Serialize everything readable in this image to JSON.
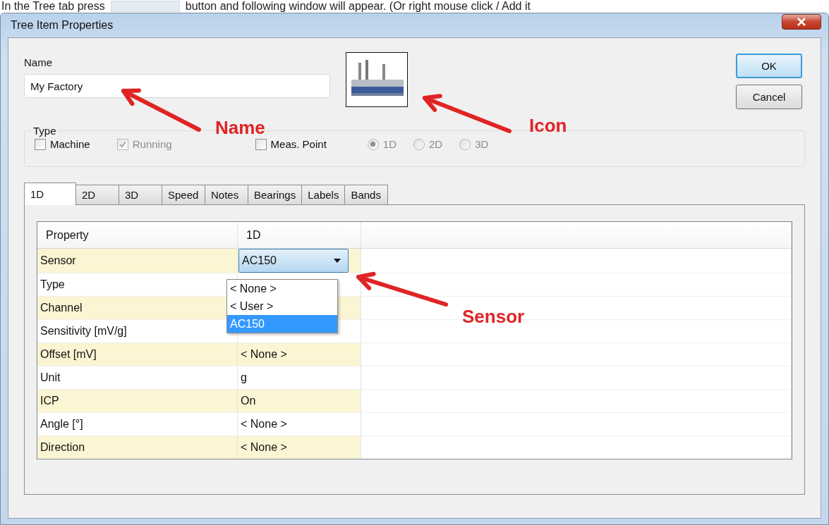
{
  "caption": {
    "before": "In the Tree tab press",
    "after": "button and following window will appear. (Or right mouse click / Add it"
  },
  "window": {
    "title": "Tree Item Properties"
  },
  "name": {
    "label": "Name",
    "value": "My Factory"
  },
  "buttons": [
    {
      "label": "OK",
      "default": true
    },
    {
      "label": "Cancel",
      "default": false
    }
  ],
  "type_group": {
    "label": "Type",
    "options": [
      {
        "kind": "checkbox",
        "label": "Machine",
        "checked": false,
        "disabled": false
      },
      {
        "kind": "checkbox",
        "label": "Running",
        "checked": true,
        "disabled": true
      },
      {
        "kind": "checkbox",
        "label": "Meas. Point",
        "checked": false,
        "disabled": false
      },
      {
        "kind": "radio",
        "label": "1D",
        "selected": true,
        "disabled": true
      },
      {
        "kind": "radio",
        "label": "2D",
        "selected": false,
        "disabled": true
      },
      {
        "kind": "radio",
        "label": "3D",
        "selected": false,
        "disabled": true
      }
    ]
  },
  "tabs": [
    {
      "label": "1D",
      "selected": true
    },
    {
      "label": "2D",
      "selected": false
    },
    {
      "label": "3D",
      "selected": false
    },
    {
      "label": "Speed",
      "selected": false
    },
    {
      "label": "Notes",
      "selected": false
    },
    {
      "label": "Bearings",
      "selected": false
    },
    {
      "label": "Labels",
      "selected": false
    },
    {
      "label": "Bands",
      "selected": false
    }
  ],
  "grid": {
    "columns": [
      "Property",
      "1D"
    ],
    "rows": [
      {
        "property": "Sensor",
        "kind": "combo",
        "value": "AC150"
      },
      {
        "property": "Type",
        "kind": "text"
      },
      {
        "property": "Channel",
        "kind": "text"
      },
      {
        "property": "Sensitivity [mV/g]",
        "kind": "text"
      },
      {
        "property": "Offset [mV]",
        "kind": "text",
        "value": "< None >"
      },
      {
        "property": "Unit",
        "kind": "text",
        "value": "g"
      },
      {
        "property": "ICP",
        "kind": "text",
        "value": "On"
      },
      {
        "property": "Angle [°]",
        "kind": "text",
        "value": "< None >"
      },
      {
        "property": "Direction",
        "kind": "text",
        "value": "< None >"
      }
    ]
  },
  "dropdown": {
    "items": [
      {
        "label": "< None >",
        "selected": false
      },
      {
        "label": "< User >",
        "selected": false
      },
      {
        "label": "AC150",
        "selected": true
      }
    ]
  },
  "annotations": [
    {
      "text": "Name"
    },
    {
      "text": "Icon"
    },
    {
      "text": "Sensor"
    }
  ]
}
